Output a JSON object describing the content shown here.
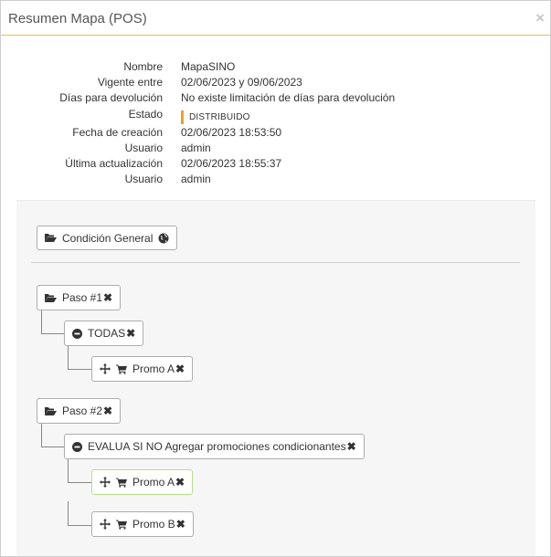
{
  "modal": {
    "title": "Resumen Mapa (POS)",
    "close_symbol": "×"
  },
  "info": {
    "rows": [
      {
        "label": "Nombre",
        "value": "MapaSINO"
      },
      {
        "label": "Vigente entre",
        "value": "02/06/2023 y 09/06/2023"
      },
      {
        "label": "Días para devolución",
        "value": "No existe limitación de días para devolución"
      },
      {
        "label": "Estado",
        "value": "DISTRIBUIDO"
      },
      {
        "label": "Fecha de creación",
        "value": "02/06/2023 18:53:50"
      },
      {
        "label": "Usuario",
        "value": "admin"
      },
      {
        "label": "Última actualización",
        "value": "02/06/2023 18:55:37"
      },
      {
        "label": "Usuario",
        "value": "admin"
      }
    ],
    "status_color": "#f0a020"
  },
  "tree": {
    "general_condition": {
      "label": "Condición General",
      "icon": "folder-open-icon",
      "trailing_icon": "globe-icon"
    },
    "steps": [
      {
        "label": "Paso #1",
        "condition": {
          "label": "TODAS"
        },
        "promos": [
          {
            "label": "Promo A",
            "highlighted": false
          }
        ]
      },
      {
        "label": "Paso #2",
        "condition": {
          "label": "EVALUA SI NO Agregar promociones condicionantes"
        },
        "promos": [
          {
            "label": "Promo A",
            "highlighted": true
          },
          {
            "label": "Promo B",
            "highlighted": false
          }
        ]
      }
    ],
    "remove_symbol": "✖"
  }
}
